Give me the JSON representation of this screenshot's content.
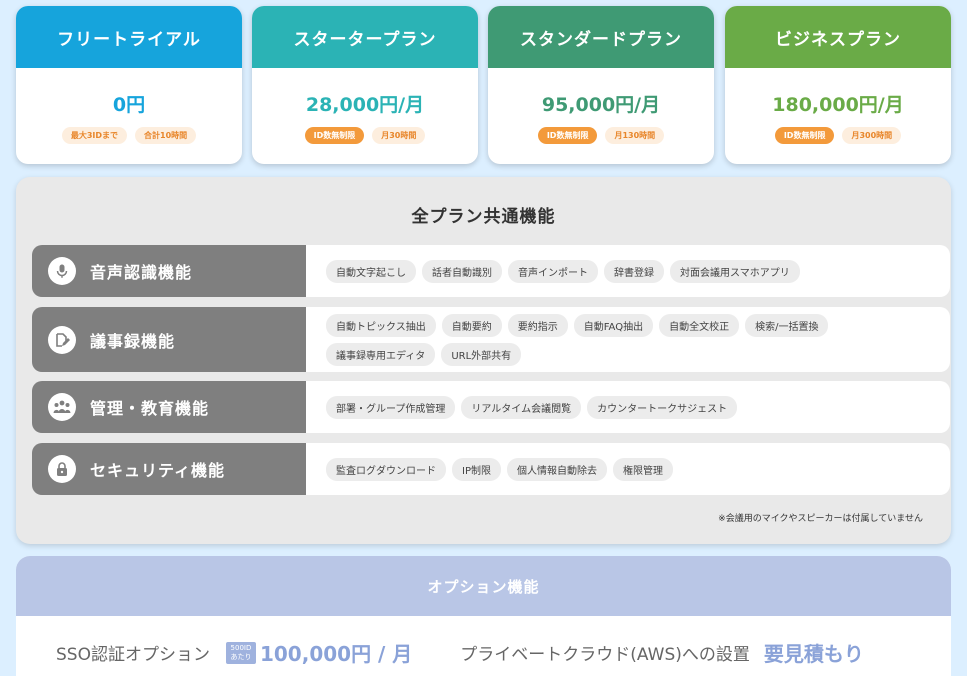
{
  "colors": {
    "trial": "#16a4dc",
    "starter": "#2bb3b5",
    "standard": "#3f9a74",
    "business": "#6aab47",
    "accent_orange": "#f39a3b",
    "feature_gray": "#7f7f7f",
    "option_blue": "#b9c6e6"
  },
  "plans": [
    {
      "name": "フリートライアル",
      "price": "0円",
      "tags": [
        "最大3IDまで",
        "合計10時間"
      ]
    },
    {
      "name": "スタータープラン",
      "price": "28,000円/月",
      "tags": [
        "ID数無制限",
        "月30時間"
      ]
    },
    {
      "name": "スタンダードプラン",
      "price": "95,000円/月",
      "tags": [
        "ID数無制限",
        "月130時間"
      ]
    },
    {
      "name": "ビジネスプラン",
      "price": "180,000円/月",
      "tags": [
        "ID数無制限",
        "月300時間"
      ]
    }
  ],
  "common": {
    "title": "全プラン共通機能",
    "features": [
      {
        "name": "音声認識機能",
        "icon": "microphone-icon",
        "items": [
          "自動文字起こし",
          "話者自動識別",
          "音声インポート",
          "辞書登録",
          "対面会議用スマホアプリ"
        ]
      },
      {
        "name": "議事録機能",
        "icon": "document-edit-icon",
        "items": [
          "自動トピックス抽出",
          "自動要約",
          "要約指示",
          "自動FAQ抽出",
          "自動全文校正",
          "検索/一括置換",
          "議事録専用エディタ",
          "URL外部共有"
        ]
      },
      {
        "name": "管理・教育機能",
        "icon": "group-icon",
        "items": [
          "部署・グループ作成管理",
          "リアルタイム会議閲覧",
          "カウンタートークサジェスト"
        ]
      },
      {
        "name": "セキュリティ機能",
        "icon": "lock-icon",
        "items": [
          "監査ログダウンロード",
          "IP制限",
          "個人情報自動除去",
          "権限管理"
        ]
      }
    ],
    "note": "※会議用のマイクやスピーカーは付属していません"
  },
  "options": {
    "title": "オプション機能",
    "sso_label": "SSO認証オプション",
    "sso_badge_line1": "500ID",
    "sso_badge_line2": "あたり",
    "sso_price": "100,000円 / 月",
    "cloud_label": "プライベートクラウド(AWS)への設置",
    "cloud_price": "要見積もり"
  }
}
